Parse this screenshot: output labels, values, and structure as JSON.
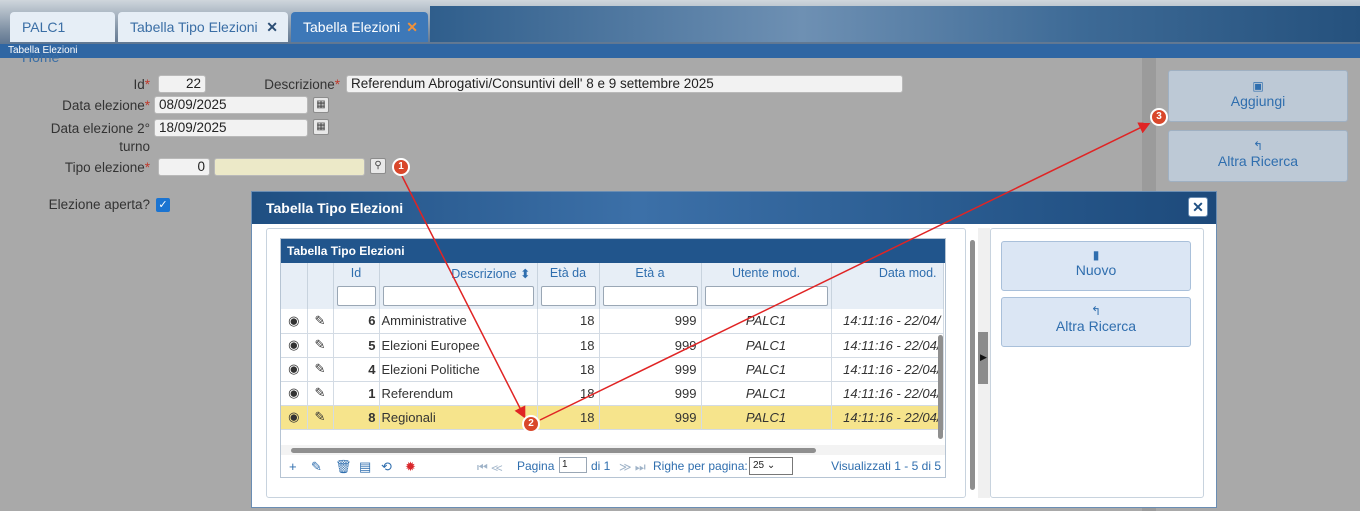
{
  "tabs": [
    {
      "label": "PALC1 Home"
    },
    {
      "label": "Tabella Tipo Elezioni",
      "close": "✕"
    },
    {
      "label": "Tabella Elezioni",
      "close": "✕"
    }
  ],
  "breadcrumb": "Tabella Elezioni",
  "form": {
    "id_label": "Id",
    "id_value": "22",
    "descrizione_label": "Descrizione",
    "descrizione_value": "Referendum Abrogativi/Consuntivi dell' 8 e 9 settembre 2025",
    "data_label": "Data elezione",
    "data_value": "08/09/2025",
    "data2_label_1": "Data elezione 2°",
    "data2_label_2": "turno",
    "data2_value": "18/09/2025",
    "tipo_label": "Tipo elezione",
    "tipo_value": "0",
    "aperta_label": "Elezione aperta?",
    "required_mark": "*"
  },
  "right_panel": {
    "add_label": "Aggiungi",
    "search_label": "Altra Ricerca"
  },
  "modal": {
    "title": "Tabella Tipo Elezioni",
    "grid_title": "Tabella Tipo Elezioni",
    "columns": [
      "Id",
      "Descrizione",
      "Età da",
      "Età a",
      "Utente mod.",
      "Data mod."
    ],
    "sort_icon": "⬍",
    "rows": [
      {
        "id": "6",
        "desc": "Amministrative",
        "da": "18",
        "a": "999",
        "user": "PALC1",
        "date": "14:11:16 - 22/04/"
      },
      {
        "id": "5",
        "desc": "Elezioni Europee",
        "da": "18",
        "a": "999",
        "user": "PALC1",
        "date": "14:11:16 - 22/04/"
      },
      {
        "id": "4",
        "desc": "Elezioni Politiche",
        "da": "18",
        "a": "999",
        "user": "PALC1",
        "date": "14:11:16 - 22/04/"
      },
      {
        "id": "1",
        "desc": "Referendum",
        "da": "18",
        "a": "999",
        "user": "PALC1",
        "date": "14:11:16 - 22/04/"
      },
      {
        "id": "8",
        "desc": "Regionali",
        "da": "18",
        "a": "999",
        "user": "PALC1",
        "date": "14:11:16 - 22/04/"
      }
    ],
    "pager": {
      "page_label": "Pagina",
      "page_value": "1",
      "of_label": "di 1",
      "rows_label": "Righe per pagina:",
      "rows_value": "25",
      "summary": "Visualizzati 1 - 5 di 5"
    },
    "new_label": "Nuovo",
    "search_label": "Altra Ricerca"
  },
  "annotations": [
    "1",
    "2",
    "3"
  ],
  "colors": {
    "accent": "#2f6eae",
    "header": "#21558c",
    "selected_row": "#f6e48c",
    "annotation": "#d9472b"
  }
}
